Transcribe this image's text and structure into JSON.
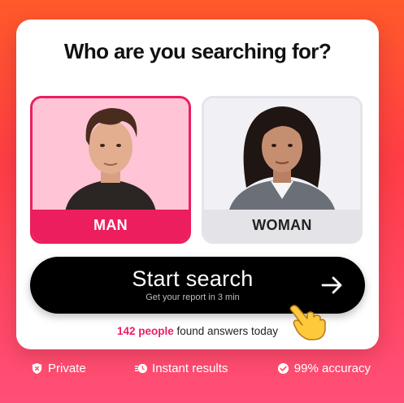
{
  "question": "Who are you searching for?",
  "options": [
    {
      "label": "MAN",
      "selected": true
    },
    {
      "label": "WOMAN",
      "selected": false
    }
  ],
  "start_button": {
    "title": "Start search",
    "subtitle": "Get your report in 3 min",
    "icon": "arrow-right-icon"
  },
  "social_proof": {
    "highlight": "142 people",
    "rest": " found answers today"
  },
  "features": [
    {
      "icon": "shield-icon",
      "label": "Private"
    },
    {
      "icon": "lightning-clock-icon",
      "label": "Instant results"
    },
    {
      "icon": "check-circle-icon",
      "label": "99% accuracy"
    }
  ],
  "colors": {
    "accent": "#ec1e5e",
    "background_top": "#ff5a2a",
    "background_bottom": "#ff4f78",
    "button": "#000000"
  }
}
